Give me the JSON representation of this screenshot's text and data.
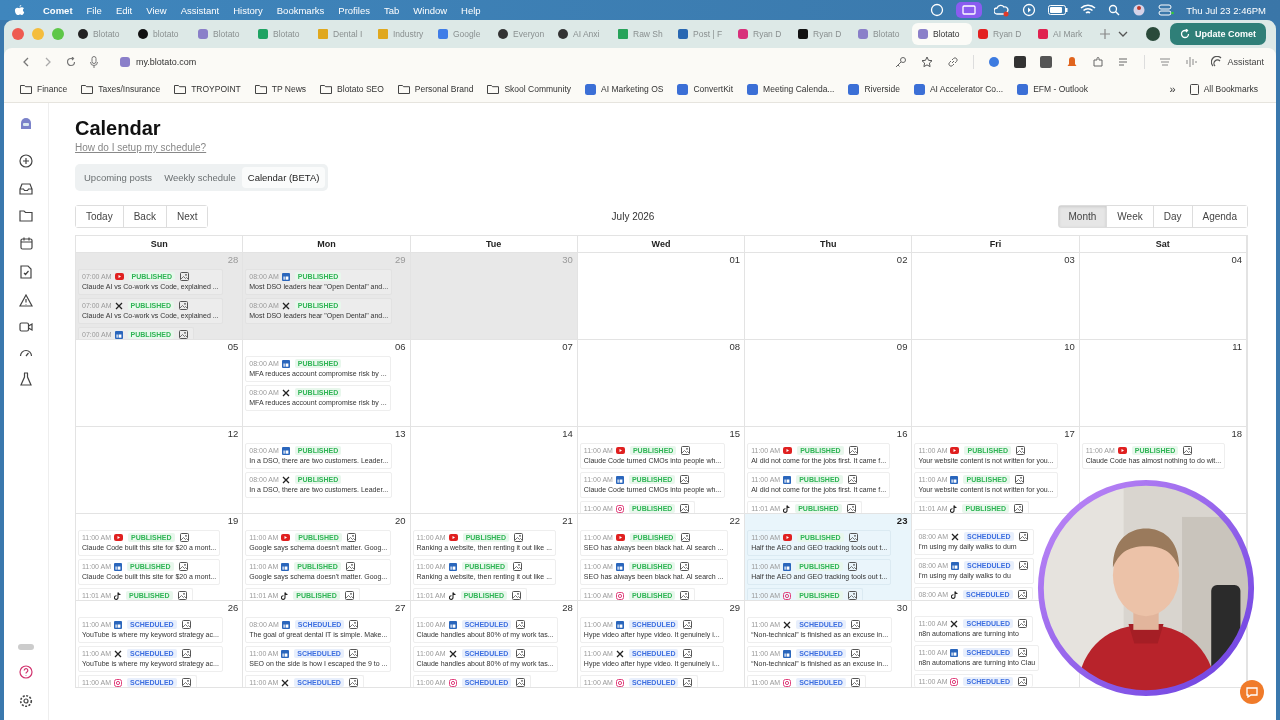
{
  "menu_bar": {
    "app": "Comet",
    "menus": [
      "File",
      "Edit",
      "View",
      "Assistant",
      "History",
      "Bookmarks",
      "Profiles",
      "Tab",
      "Window",
      "Help"
    ],
    "clock": "Thu Jul 23  2:46PM"
  },
  "tabs": [
    {
      "title": "Blotato",
      "selected": false
    },
    {
      "title": "blotato",
      "selected": false
    },
    {
      "title": "Blotato",
      "selected": false
    },
    {
      "title": "Blotato",
      "selected": false
    },
    {
      "title": "Dental I",
      "selected": false
    },
    {
      "title": "Industry",
      "selected": false
    },
    {
      "title": "Google",
      "selected": false
    },
    {
      "title": "Everyon",
      "selected": false
    },
    {
      "title": "AI Anxi",
      "selected": false
    },
    {
      "title": "Raw Sh",
      "selected": false
    },
    {
      "title": "Post | F",
      "selected": false
    },
    {
      "title": "Ryan D",
      "selected": false
    },
    {
      "title": "Ryan D",
      "selected": false
    },
    {
      "title": "Blotato",
      "selected": false
    },
    {
      "title": "Blotato",
      "selected": true
    },
    {
      "title": "Ryan D",
      "selected": false
    },
    {
      "title": "AI Mark",
      "selected": false
    }
  ],
  "update_button": "Update Comet",
  "address": "my.blotato.com",
  "assistant_button": "Assistant",
  "bookmarks": [
    {
      "label": "Finance",
      "kind": "folder"
    },
    {
      "label": "Taxes/Insurance",
      "kind": "folder"
    },
    {
      "label": "TROYPOINT",
      "kind": "folder"
    },
    {
      "label": "TP News",
      "kind": "folder"
    },
    {
      "label": "Blotato SEO",
      "kind": "folder"
    },
    {
      "label": "Personal Brand",
      "kind": "folder"
    },
    {
      "label": "Skool Community",
      "kind": "folder"
    },
    {
      "label": "AI Marketing OS",
      "kind": "site"
    },
    {
      "label": "ConvertKit",
      "kind": "site"
    },
    {
      "label": "Meeting Calenda...",
      "kind": "site"
    },
    {
      "label": "Riverside",
      "kind": "site"
    },
    {
      "label": "AI Accelerator Co...",
      "kind": "site"
    },
    {
      "label": "EFM - Outlook",
      "kind": "site"
    }
  ],
  "bookmarks_more": "»",
  "all_bookmarks": "All Bookmarks",
  "page": {
    "title": "Calendar",
    "help_link": "How do I setup my schedule?",
    "view_tabs": [
      {
        "label": "Upcoming posts",
        "selected": false
      },
      {
        "label": "Weekly schedule",
        "selected": false
      },
      {
        "label": "Calendar (BETA)",
        "selected": true
      }
    ],
    "nav_buttons": [
      "Today",
      "Back",
      "Next"
    ],
    "month_label": "July 2026",
    "range_buttons": [
      {
        "label": "Month",
        "selected": true
      },
      {
        "label": "Week",
        "selected": false
      },
      {
        "label": "Day",
        "selected": false
      },
      {
        "label": "Agenda",
        "selected": false
      }
    ],
    "weekdays": [
      "Sun",
      "Mon",
      "Tue",
      "Wed",
      "Thu",
      "Fri",
      "Sat"
    ],
    "weeks": [
      [
        {
          "day": "28",
          "muted": true,
          "today": false,
          "posts": [
            {
              "time": "07:00 AM",
              "kind": "youtube",
              "status": "PUBLISHED",
              "scheduled": false,
              "image": true,
              "text": "Claude AI vs Co-work vs Code, explained ..."
            },
            {
              "time": "07:00 AM",
              "kind": "x",
              "status": "PUBLISHED",
              "scheduled": false,
              "image": true,
              "text": "Claude AI vs Co-work vs Code, explained ..."
            },
            {
              "time": "07:00 AM",
              "kind": "linkedin",
              "status": "PUBLISHED",
              "scheduled": false,
              "image": true
            }
          ]
        },
        {
          "day": "29",
          "muted": true,
          "today": false,
          "posts": [
            {
              "time": "08:00 AM",
              "kind": "linkedin",
              "status": "PUBLISHED",
              "scheduled": false,
              "image": false,
              "text": "Most DSO leaders hear \"Open Dental\" and..."
            },
            {
              "time": "08:00 AM",
              "kind": "x",
              "status": "PUBLISHED",
              "scheduled": false,
              "image": false,
              "text": "Most DSO leaders hear \"Open Dental\" and..."
            }
          ]
        },
        {
          "day": "30",
          "muted": true,
          "today": false
        },
        {
          "day": "01",
          "muted": false,
          "today": false
        },
        {
          "day": "02",
          "muted": false,
          "today": false
        },
        {
          "day": "03",
          "muted": false,
          "today": false
        },
        {
          "day": "04",
          "muted": false,
          "today": false
        }
      ],
      [
        {
          "day": "05",
          "muted": false,
          "today": false
        },
        {
          "day": "06",
          "muted": false,
          "today": false,
          "posts": [
            {
              "time": "08:00 AM",
              "kind": "linkedin",
              "status": "PUBLISHED",
              "scheduled": false,
              "image": false,
              "text": "MFA reduces account compromise risk by ..."
            },
            {
              "time": "08:00 AM",
              "kind": "x",
              "status": "PUBLISHED",
              "scheduled": false,
              "image": false,
              "text": "MFA reduces account compromise risk by ..."
            }
          ]
        },
        {
          "day": "07",
          "muted": false,
          "today": false
        },
        {
          "day": "08",
          "muted": false,
          "today": false
        },
        {
          "day": "09",
          "muted": false,
          "today": false
        },
        {
          "day": "10",
          "muted": false,
          "today": false
        },
        {
          "day": "11",
          "muted": false,
          "today": false
        }
      ],
      [
        {
          "day": "12",
          "muted": false,
          "today": false
        },
        {
          "day": "13",
          "muted": false,
          "today": false,
          "posts": [
            {
              "time": "08:00 AM",
              "kind": "linkedin",
              "status": "PUBLISHED",
              "scheduled": false,
              "image": false,
              "text": "In a DSO, there are two customers. Leader..."
            },
            {
              "time": "08:00 AM",
              "kind": "x",
              "status": "PUBLISHED",
              "scheduled": false,
              "image": false,
              "text": "In a DSO, there are two customers. Leader..."
            }
          ]
        },
        {
          "day": "14",
          "muted": false,
          "today": false
        },
        {
          "day": "15",
          "muted": false,
          "today": false,
          "posts": [
            {
              "time": "11:00 AM",
              "kind": "youtube",
              "status": "PUBLISHED",
              "scheduled": false,
              "image": true,
              "text": "Claude Code turned CMOs into people wh..."
            },
            {
              "time": "11:00 AM",
              "kind": "linkedin",
              "status": "PUBLISHED",
              "scheduled": false,
              "image": true,
              "text": "Claude Code turned CMOs into people wh..."
            },
            {
              "time": "11:00 AM",
              "kind": "instagram",
              "status": "PUBLISHED",
              "scheduled": false,
              "image": true
            }
          ]
        },
        {
          "day": "16",
          "muted": false,
          "today": false,
          "posts": [
            {
              "time": "11:00 AM",
              "kind": "youtube",
              "status": "PUBLISHED",
              "scheduled": false,
              "image": true,
              "text": "AI did not come for the jobs first. It came f..."
            },
            {
              "time": "11:00 AM",
              "kind": "linkedin",
              "status": "PUBLISHED",
              "scheduled": false,
              "image": true,
              "text": "AI did not come for the jobs first. It came f..."
            },
            {
              "time": "11:01 AM",
              "kind": "tiktok",
              "status": "PUBLISHED",
              "scheduled": false,
              "image": true
            }
          ]
        },
        {
          "day": "17",
          "muted": false,
          "today": false,
          "posts": [
            {
              "time": "11:00 AM",
              "kind": "youtube",
              "status": "PUBLISHED",
              "scheduled": false,
              "image": true,
              "text": "Your website content is not written for you..."
            },
            {
              "time": "11:00 AM",
              "kind": "linkedin",
              "status": "PUBLISHED",
              "scheduled": false,
              "image": true,
              "text": "Your website content is not written for you..."
            },
            {
              "time": "11:01 AM",
              "kind": "tiktok",
              "status": "PUBLISHED",
              "scheduled": false,
              "image": true
            }
          ]
        },
        {
          "day": "18",
          "muted": false,
          "today": false,
          "posts": [
            {
              "time": "11:00 AM",
              "kind": "youtube",
              "status": "PUBLISHED",
              "scheduled": false,
              "image": true,
              "text": "Claude Code has almost nothing to do wit..."
            }
          ]
        }
      ],
      [
        {
          "day": "19",
          "muted": false,
          "today": false,
          "posts": [
            {
              "time": "11:00 AM",
              "kind": "youtube",
              "status": "PUBLISHED",
              "scheduled": false,
              "image": true,
              "text": "Claude Code built this site for $20 a mont..."
            },
            {
              "time": "11:00 AM",
              "kind": "linkedin",
              "status": "PUBLISHED",
              "scheduled": false,
              "image": true,
              "text": "Claude Code built this site for $20 a mont..."
            },
            {
              "time": "11:01 AM",
              "kind": "tiktok",
              "status": "PUBLISHED",
              "scheduled": false,
              "image": true
            }
          ]
        },
        {
          "day": "20",
          "muted": false,
          "today": false,
          "posts": [
            {
              "time": "11:00 AM",
              "kind": "youtube",
              "status": "PUBLISHED",
              "scheduled": false,
              "image": true,
              "text": "Google says schema doesn't matter. Goog..."
            },
            {
              "time": "11:00 AM",
              "kind": "linkedin",
              "status": "PUBLISHED",
              "scheduled": false,
              "image": true,
              "text": "Google says schema doesn't matter. Goog..."
            },
            {
              "time": "11:01 AM",
              "kind": "tiktok",
              "status": "PUBLISHED",
              "scheduled": false,
              "image": true
            }
          ]
        },
        {
          "day": "21",
          "muted": false,
          "today": false,
          "posts": [
            {
              "time": "11:00 AM",
              "kind": "youtube",
              "status": "PUBLISHED",
              "scheduled": false,
              "image": true,
              "text": "Ranking a website, then renting it out like ..."
            },
            {
              "time": "11:00 AM",
              "kind": "linkedin",
              "status": "PUBLISHED",
              "scheduled": false,
              "image": true,
              "text": "Ranking a website, then renting it out like ..."
            },
            {
              "time": "11:01 AM",
              "kind": "tiktok",
              "status": "PUBLISHED",
              "scheduled": false,
              "image": true
            }
          ]
        },
        {
          "day": "22",
          "muted": false,
          "today": false,
          "posts": [
            {
              "time": "11:00 AM",
              "kind": "youtube",
              "status": "PUBLISHED",
              "scheduled": false,
              "image": true,
              "text": "SEO has always been black hat. AI search ..."
            },
            {
              "time": "11:00 AM",
              "kind": "linkedin",
              "status": "PUBLISHED",
              "scheduled": false,
              "image": true,
              "text": "SEO has always been black hat. AI search ..."
            },
            {
              "time": "11:00 AM",
              "kind": "instagram",
              "status": "PUBLISHED",
              "scheduled": false,
              "image": true
            }
          ]
        },
        {
          "day": "23",
          "muted": false,
          "today": true,
          "posts": [
            {
              "time": "11:00 AM",
              "kind": "youtube",
              "status": "PUBLISHED",
              "scheduled": false,
              "image": true,
              "text": "Half the AEO and GEO tracking tools out t..."
            },
            {
              "time": "11:00 AM",
              "kind": "linkedin",
              "status": "PUBLISHED",
              "scheduled": false,
              "image": true,
              "text": "Half the AEO and GEO tracking tools out t..."
            },
            {
              "time": "11:00 AM",
              "kind": "instagram",
              "status": "PUBLISHED",
              "scheduled": false,
              "image": true
            }
          ]
        },
        {
          "posts": [
            {
              "time": "08:00 AM",
              "kind": "x",
              "status": "SCHEDULED",
              "scheduled": true,
              "image": true,
              "text": "I'm using my daily walks to dum"
            },
            {
              "time": "08:00 AM",
              "kind": "linkedin",
              "status": "SCHEDULED",
              "scheduled": true,
              "image": true,
              "text": "I'm using my daily walks to du"
            },
            {
              "time": "08:00 AM",
              "kind": "tiktok",
              "status": "SCHEDULED",
              "scheduled": true,
              "image": true
            }
          ]
        }
      ],
      [
        {
          "day": "26",
          "muted": false,
          "today": false,
          "posts": [
            {
              "time": "11:00 AM",
              "kind": "linkedin",
              "status": "SCHEDULED",
              "scheduled": true,
              "image": true,
              "text": "YouTube is where my keyword strategy ac..."
            },
            {
              "time": "11:00 AM",
              "kind": "x",
              "status": "SCHEDULED",
              "scheduled": true,
              "image": true,
              "text": "YouTube is where my keyword strategy ac..."
            },
            {
              "time": "11:00 AM",
              "kind": "instagram",
              "status": "SCHEDULED",
              "scheduled": true,
              "image": true
            }
          ]
        },
        {
          "day": "27",
          "muted": false,
          "today": false,
          "posts": [
            {
              "time": "08:00 AM",
              "kind": "linkedin",
              "status": "SCHEDULED",
              "scheduled": true,
              "image": true,
              "text": "The goal of great dental IT is simple. Make..."
            },
            {
              "time": "11:00 AM",
              "kind": "linkedin",
              "status": "SCHEDULED",
              "scheduled": true,
              "image": true,
              "text": "SEO on the side is how I escaped the 9 to ..."
            },
            {
              "time": "11:00 AM",
              "kind": "x",
              "status": "SCHEDULED",
              "scheduled": true,
              "image": true
            }
          ]
        },
        {
          "day": "28",
          "muted": false,
          "today": false,
          "posts": [
            {
              "time": "11:00 AM",
              "kind": "linkedin",
              "status": "SCHEDULED",
              "scheduled": true,
              "image": true,
              "text": "Claude handles about 80% of my work tas..."
            },
            {
              "time": "11:00 AM",
              "kind": "x",
              "status": "SCHEDULED",
              "scheduled": true,
              "image": true,
              "text": "Claude handles about 80% of my work tas..."
            },
            {
              "time": "11:00 AM",
              "kind": "instagram",
              "status": "SCHEDULED",
              "scheduled": true,
              "image": true
            }
          ]
        },
        {
          "day": "29",
          "muted": false,
          "today": false,
          "posts": [
            {
              "time": "11:00 AM",
              "kind": "linkedin",
              "status": "SCHEDULED",
              "scheduled": true,
              "image": true,
              "text": "Hype video after hype video. It genuinely i..."
            },
            {
              "time": "11:00 AM",
              "kind": "x",
              "status": "SCHEDULED",
              "scheduled": true,
              "image": true,
              "text": "Hype video after hype video. It genuinely i..."
            },
            {
              "time": "11:00 AM",
              "kind": "instagram",
              "status": "SCHEDULED",
              "scheduled": true,
              "image": true
            }
          ]
        },
        {
          "day": "30",
          "muted": false,
          "today": false,
          "posts": [
            {
              "time": "11:00 AM",
              "kind": "x",
              "status": "SCHEDULED",
              "scheduled": true,
              "image": true,
              "text": "“Non-technical” is finished as an excuse in..."
            },
            {
              "time": "11:00 AM",
              "kind": "linkedin",
              "status": "SCHEDULED",
              "scheduled": true,
              "image": true,
              "text": "“Non-technical” is finished as an excuse in..."
            },
            {
              "time": "11:00 AM",
              "kind": "instagram",
              "status": "SCHEDULED",
              "scheduled": true,
              "image": true
            }
          ]
        },
        {
          "posts": [
            {
              "time": "11:00 AM",
              "kind": "x",
              "status": "SCHEDULED",
              "scheduled": true,
              "image": true,
              "text": "n8n automations are turning into"
            },
            {
              "time": "11:00 AM",
              "kind": "linkedin",
              "status": "SCHEDULED",
              "scheduled": true,
              "image": true,
              "text": "n8n automations are turning into Clau"
            },
            {
              "time": "11:00 AM",
              "kind": "instagram",
              "status": "SCHEDULED",
              "scheduled": true,
              "image": true
            }
          ]
        }
      ]
    ]
  }
}
